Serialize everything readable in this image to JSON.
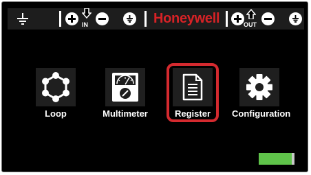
{
  "brand": {
    "name": "Honeywell",
    "color": "#d62226"
  },
  "topbar": {
    "ground_icon": "ground-icon",
    "input_group": {
      "plus_icon": "plus-circle-icon",
      "direction_label": "IN",
      "minus_icon": "minus-circle-icon",
      "ground_icon": "ground-circle-icon"
    },
    "output_group": {
      "plus_icon": "plus-circle-icon",
      "direction_label": "OUT",
      "minus_icon": "minus-circle-icon",
      "ground_icon": "ground-circle-icon"
    }
  },
  "menu": {
    "items": [
      {
        "label": "Loop",
        "icon": "loop-icon"
      },
      {
        "label": "Multimeter",
        "icon": "multimeter-icon"
      },
      {
        "label": "Register",
        "icon": "document-icon",
        "selected": true
      },
      {
        "label": "Configuration",
        "icon": "gear-icon"
      }
    ],
    "selection_color": "#d42a2f"
  },
  "battery": {
    "icon": "battery-icon",
    "level": 0.92,
    "color": "#5fc34a"
  }
}
